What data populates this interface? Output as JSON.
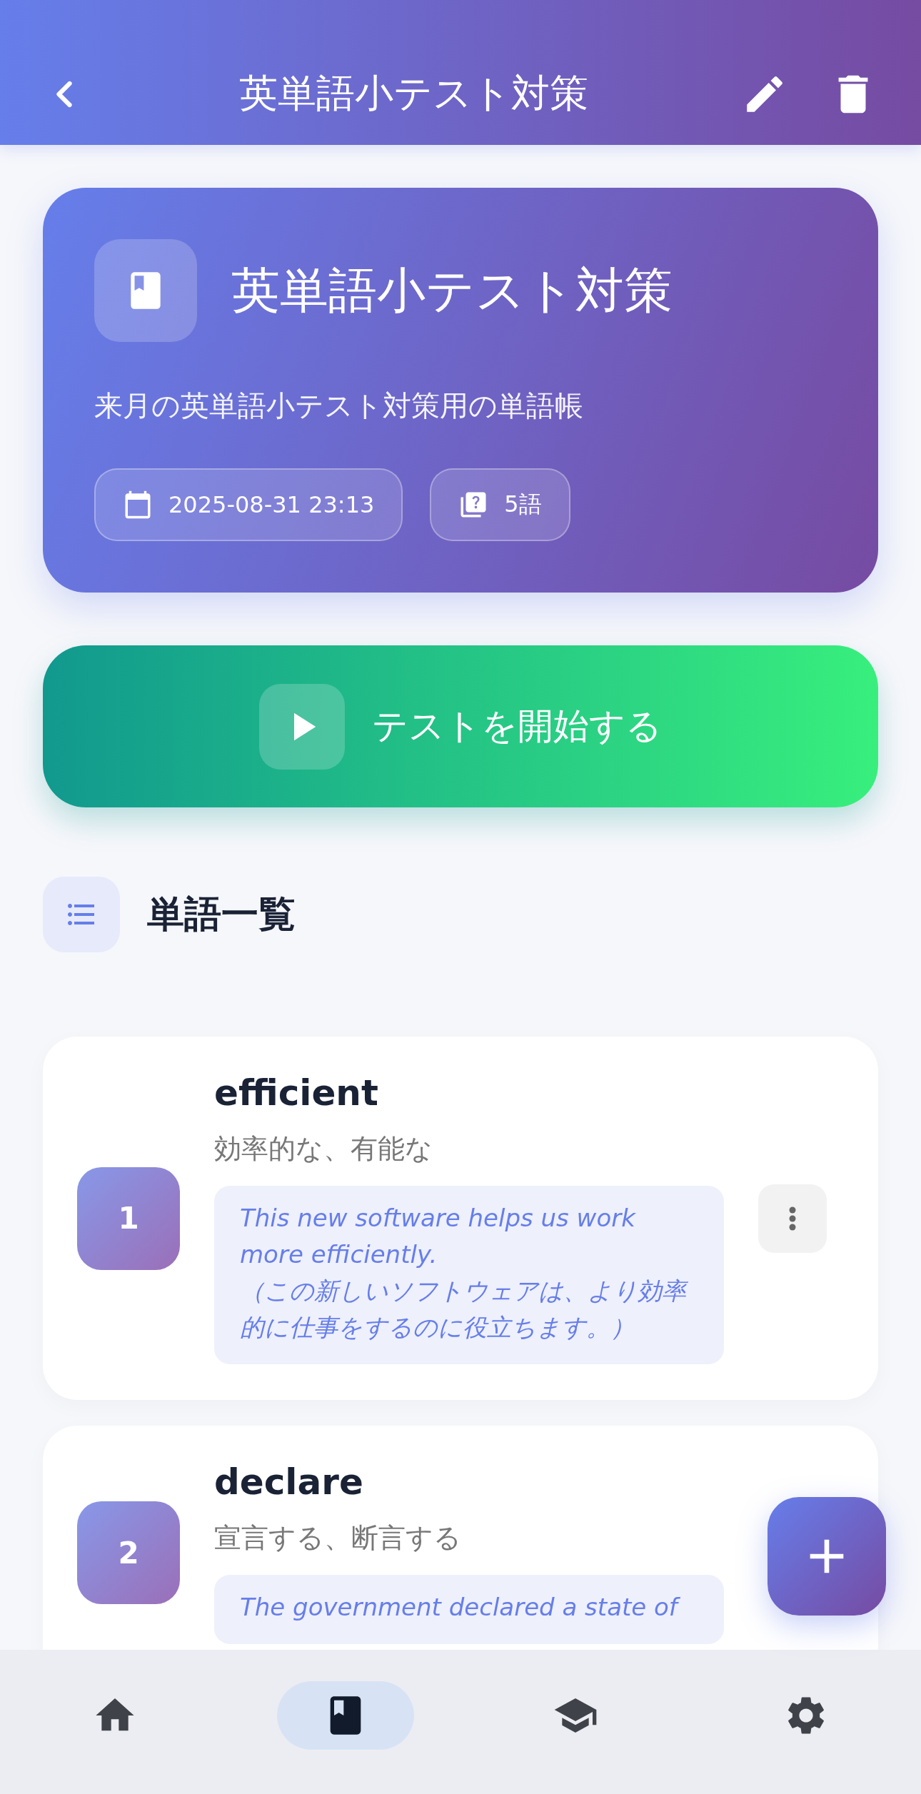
{
  "header": {
    "title": "英単語小テスト対策"
  },
  "wordbook": {
    "title": "英単語小テスト対策",
    "description": "来月の英単語小テスト対策用の単語帳",
    "chips": [
      {
        "kind": "date",
        "text": "2025-08-31 23:13"
      },
      {
        "kind": "count",
        "text": "5語"
      }
    ]
  },
  "start_button": "テストを開始する",
  "section_title": "単語一覧",
  "words": [
    {
      "number": "1",
      "more_button": true,
      "word": "efficient",
      "meaning": "効率的な、有能な",
      "example": "This new software helps us work more efficiently.\n（この新しいソフトウェアは、より効率的に仕事をするのに役立ちます。）"
    },
    {
      "number": "2",
      "more_button": false,
      "word": "declare",
      "meaning": "宣言する、断言する",
      "example": "The government declared a state of"
    }
  ],
  "nav": [
    {
      "kind": "home",
      "selected": false
    },
    {
      "kind": "wordbook",
      "selected": true
    },
    {
      "kind": "study",
      "selected": false
    },
    {
      "kind": "settings",
      "selected": false
    }
  ]
}
